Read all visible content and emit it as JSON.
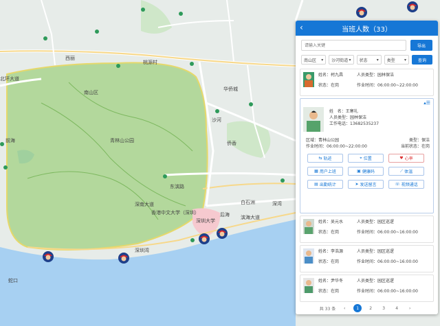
{
  "panel": {
    "title": "当班人数（33）",
    "search_placeholder": "请输入关键",
    "export_label": "导出",
    "query_label": "查询",
    "filters": [
      "南山区",
      "沙河街道",
      "状态",
      "类型"
    ]
  },
  "workers": [
    {
      "name_label": "姓名：",
      "name": "柯九昌",
      "type_label": "人员类型：",
      "type": "园林保洁",
      "status_label": "状态：",
      "status": "在岗",
      "time_label": "作业时间：",
      "time": "06:00:00~22:00:00"
    },
    {
      "name_label": "姓名：",
      "name": "吴元水",
      "type_label": "人员类型：",
      "type": "园区巡逻",
      "status_label": "状态：",
      "status": "在岗",
      "time_label": "作业时间：",
      "time": "06:00:00~16:00:00"
    },
    {
      "name_label": "姓名：",
      "name": "李浩源",
      "type_label": "人员类型：",
      "type": "园区巡逻",
      "status_label": "状态：",
      "status": "在岗",
      "time_label": "作业时间：",
      "time": "06:00:00~16:00:00"
    },
    {
      "name_label": "姓名：",
      "name": "尹华冬",
      "type_label": "人员类型：",
      "type": "园区巡逻",
      "status_label": "状态：",
      "status": "在岗",
      "time_label": "作业时间：",
      "time": "06:00:00~16:00:00"
    }
  ],
  "expanded": {
    "name_label": "姓",
    "name_label2": "名：",
    "name": "王寒礼",
    "type_label": "人员类型：",
    "type": "园林保洁",
    "phone_label": "工作电话：",
    "phone": "13682535237",
    "area_label": "区域：",
    "area": "青林山公园",
    "time_label": "作业时间：",
    "time": "06:00:00~22:00:00",
    "status_type_label": "类型：",
    "status_type": "保洁",
    "duty_label": "当前状态：",
    "duty": "在岗",
    "actions": [
      "轨迹",
      "位置",
      "心率",
      "用户上班",
      "健康码",
      "体温",
      "出勤统计",
      "发送留言",
      "视频通话"
    ]
  },
  "pager": {
    "total": "共 33 条",
    "pages": [
      "1",
      "2",
      "3",
      "4"
    ],
    "current": "1"
  },
  "map_labels": [
    "桃源村",
    "西丽",
    "南山区",
    "深圳大学",
    "后海",
    "沙河",
    "白石洲",
    "深湾",
    "华侨城",
    "青林山公园",
    "深圳湾",
    "蛇口",
    "东滨路",
    "滨海大道",
    "前海",
    "侨香",
    "深南大道",
    "香港中文大学（深圳）",
    "北环大道"
  ],
  "colors": {
    "accent": "#1677d6",
    "park_area": "#9cd07b",
    "water": "#a7d0f2"
  }
}
